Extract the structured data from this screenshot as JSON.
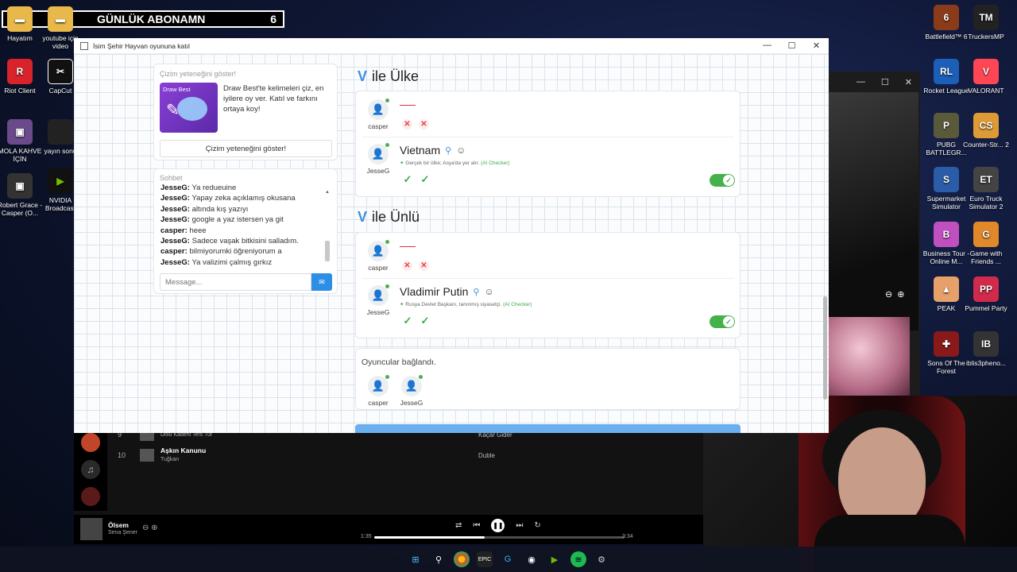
{
  "overlay": {
    "title": "GÜNLÜK ABONAMN",
    "count": "6"
  },
  "desktop_left": [
    {
      "label": "Hayatım",
      "icon": "folder-icon"
    },
    {
      "label": "youtube için video",
      "icon": "folder-icon"
    },
    {
      "label": "Riot Client",
      "icon": "riot-client-icon"
    },
    {
      "label": "CapCut",
      "icon": "capcut-icon"
    },
    {
      "label": "MOLA KAHVE İÇİN",
      "icon": "image-file-icon"
    },
    {
      "label": "yayın sonu",
      "icon": "image-file-icon"
    },
    {
      "label": "Robert Grace - Casper (O...",
      "icon": "image-file-icon"
    },
    {
      "label": "NVIDIA Broadcast",
      "icon": "nvidia-icon"
    }
  ],
  "desktop_right": [
    {
      "label": "Battlefield™ 6",
      "icon": "battlefield-icon"
    },
    {
      "label": "TruckersMP",
      "icon": "truckersmp-icon"
    },
    {
      "label": "Rocket League",
      "icon": "rocket-league-icon"
    },
    {
      "label": "VALORANT",
      "icon": "valorant-icon"
    },
    {
      "label": "PUBG BATTLEGR...",
      "icon": "pubg-icon"
    },
    {
      "label": "Counter-Str... 2",
      "icon": "counter-strike-icon"
    },
    {
      "label": "Supermarket Simulator",
      "icon": "supermarket-icon"
    },
    {
      "label": "Euro Truck Simulator 2",
      "icon": "euro-truck-icon"
    },
    {
      "label": "Business Tour - Online M...",
      "icon": "business-tour-icon"
    },
    {
      "label": "Game with Friends ...",
      "icon": "game-with-friends-icon"
    },
    {
      "label": "PEAK",
      "icon": "peak-icon"
    },
    {
      "label": "Pummel Party",
      "icon": "pummel-party-icon"
    },
    {
      "label": "Sons Of The Forest",
      "icon": "sons-of-forest-icon"
    },
    {
      "label": "iblis3pheno...",
      "icon": "iblis-icon"
    }
  ],
  "app": {
    "title": "İsim Şehir Hayvan oyununa katıl",
    "promo": {
      "heading": "Çizim yeteneğini göster!",
      "image_text": "Draw Best",
      "description": "Draw Best'te kelimeleri çiz, en iyilere oy ver. Katıl ve farkını ortaya koy!",
      "button": "Çizim yeteneğini göster!"
    },
    "chat": {
      "heading": "Sohbet",
      "messages": [
        {
          "user": "JesseG:",
          "text": "Ya redueuine"
        },
        {
          "user": "JesseG:",
          "text": "Yapay zeka açıklamış okusana"
        },
        {
          "user": "JesseG:",
          "text": "altında kış yazıyı"
        },
        {
          "user": "JesseG:",
          "text": "google a yaz istersen ya git"
        },
        {
          "user": "casper:",
          "text": "heee"
        },
        {
          "user": "JesseG:",
          "text": "Sadece vaşak bitkisini salladım."
        },
        {
          "user": "casper:",
          "text": "bilmiyorumki öğreniyorum a"
        },
        {
          "user": "JesseG:",
          "text": "Ya valizimi çalmış gırkız"
        }
      ],
      "placeholder": "Message..."
    },
    "sections": [
      {
        "letter": "V",
        "category": "ile Ülke",
        "answers": [
          {
            "player": "casper",
            "answer": "",
            "marks": [
              "✕",
              "✕"
            ]
          },
          {
            "player": "JesseG",
            "answer": "Vietnam",
            "note": "Gerçek bir ülke; Asya'da yer alır.",
            "checker": "(AI Checker)",
            "marks": [
              "✓",
              "✓"
            ]
          }
        ]
      },
      {
        "letter": "V",
        "category": "ile Ünlü",
        "answers": [
          {
            "player": "casper",
            "answer": "",
            "marks": [
              "✕",
              "✕"
            ]
          },
          {
            "player": "JesseG",
            "answer": "Vladimir Putin",
            "note": "Rusya Devlet Başkanı, tanınmış siyasetçi.",
            "checker": "(AI Checker)",
            "marks": [
              "✓",
              "✓"
            ]
          }
        ]
      }
    ],
    "players_status": {
      "text": "Oyuncular bağlandı.",
      "players": [
        "casper",
        "JesseG"
      ]
    }
  },
  "spotify": {
    "tracks": [
      {
        "num": "9",
        "title": "",
        "artist": "Dolu Kadehi Ters Tut",
        "album": "Kaçar Gider"
      },
      {
        "num": "10",
        "title": "Aşkın Kanunu",
        "artist": "Tuğkan",
        "album": "Duble"
      }
    ],
    "now_playing": {
      "title": "Ölsem",
      "artist": "Sena Şener",
      "elapsed": "1:35",
      "total": "3:34",
      "progress": 0.44
    }
  },
  "colors": {
    "accent": "#3b8fe0",
    "ok": "#45b14a",
    "bad": "#e04848"
  }
}
